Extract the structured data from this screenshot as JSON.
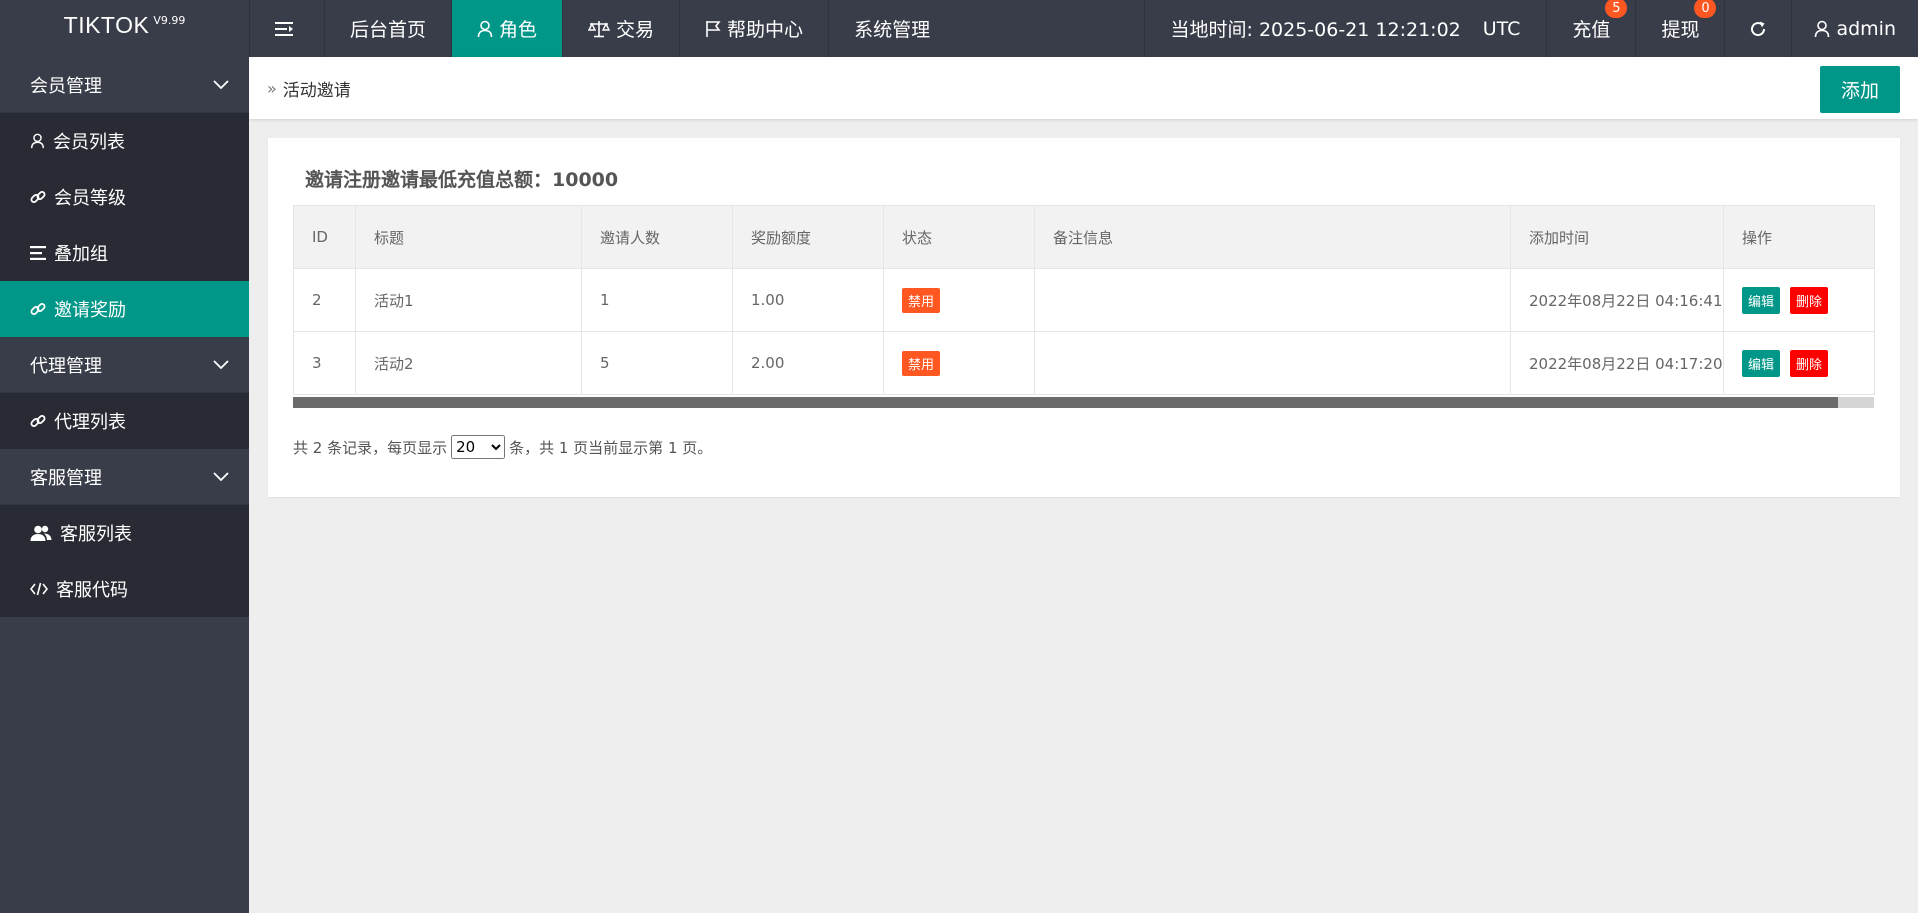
{
  "app": {
    "logo": "TIKTOK",
    "version": "V9.99"
  },
  "topnav": {
    "items": [
      {
        "label": "后台首页"
      },
      {
        "label": "角色",
        "icon": "user-icon"
      },
      {
        "label": "交易",
        "icon": "scale-icon"
      },
      {
        "label": "帮助中心",
        "icon": "flag-icon"
      },
      {
        "label": "系统管理"
      }
    ],
    "time_label": "当地时间: 2025-06-21 12:21:02",
    "timezone": "UTC",
    "recharge": {
      "label": "充值",
      "badge": "5"
    },
    "withdraw": {
      "label": "提现",
      "badge": "0"
    },
    "user": "admin"
  },
  "sidebar": {
    "groups": [
      {
        "label": "会员管理",
        "items": [
          {
            "label": "会员列表",
            "icon": "user-icon"
          },
          {
            "label": "会员等级",
            "icon": "link-icon"
          },
          {
            "label": "叠加组",
            "icon": "list-icon"
          },
          {
            "label": "邀请奖励",
            "icon": "link-icon"
          }
        ]
      },
      {
        "label": "代理管理",
        "items": [
          {
            "label": "代理列表",
            "icon": "link-icon"
          }
        ]
      },
      {
        "label": "客服管理",
        "items": [
          {
            "label": "客服列表",
            "icon": "users-icon"
          },
          {
            "label": "客服代码",
            "icon": "code-icon"
          }
        ]
      }
    ]
  },
  "breadcrumb": {
    "current": "活动邀请"
  },
  "header": {
    "add_label": "添加"
  },
  "summary": {
    "title": "邀请注册邀请最低充值总额：10000"
  },
  "table": {
    "columns": [
      "ID",
      "标题",
      "邀请人数",
      "奖励额度",
      "状态",
      "备注信息",
      "添加时间",
      "操作"
    ],
    "rows": [
      {
        "id": "2",
        "title": "活动1",
        "invites": "1",
        "reward": "1.00",
        "status": "禁用",
        "note": "",
        "added": "2022年08月22日 04:16:41"
      },
      {
        "id": "3",
        "title": "活动2",
        "invites": "5",
        "reward": "2.00",
        "status": "禁用",
        "note": "",
        "added": "2022年08月22日 04:17:20"
      }
    ],
    "edit_label": "编辑",
    "delete_label": "删除"
  },
  "pager": {
    "prefix": "共 2 条记录，每页显示",
    "page_size": "20",
    "suffix": "条，共 1 页当前显示第 1 页。"
  },
  "colors": {
    "accent": "#009688",
    "topbar": "#393d49",
    "sidebar_item": "#282b33",
    "danger": "#ff0000",
    "warn": "#ff5722"
  }
}
